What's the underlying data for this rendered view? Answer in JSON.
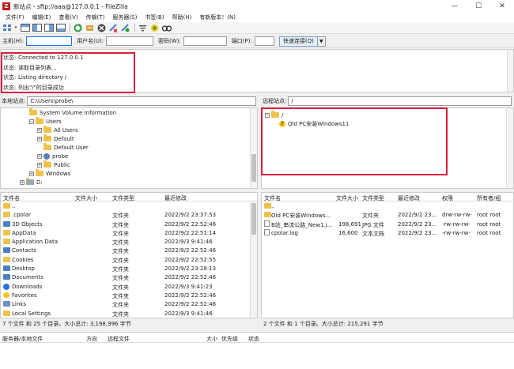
{
  "window": {
    "title": "新站点 - sftp://aaa@127.0.0.1 - FileZilla",
    "app_icon": "Z",
    "minimize": "—",
    "maximize": "☐",
    "close": "✕"
  },
  "menu": [
    "文件(F)",
    "编辑(E)",
    "查看(V)",
    "传输(T)",
    "服务器(S)",
    "书签(B)",
    "帮助(H)",
    "有新版本！(N)"
  ],
  "quickconnect": {
    "host_label": "主机(H):",
    "host_value": "",
    "user_label": "用户名(U):",
    "user_value": "",
    "pass_label": "密码(W):",
    "pass_value": "",
    "port_label": "端口(P):",
    "port_value": "",
    "connect_label": "快速连接(Q)",
    "dropdown": "▼"
  },
  "log": [
    {
      "key": "状态:",
      "msg": "Connected to 127.0.0.1"
    },
    {
      "key": "状态:",
      "msg": "读取目录列表..."
    },
    {
      "key": "状态:",
      "msg": "Listing directory /"
    },
    {
      "key": "状态:",
      "msg": "列出\"/\"的目录成功"
    }
  ],
  "local": {
    "site_label": "本地站点:",
    "path": "C:\\Users\\probe\\",
    "tree": [
      {
        "label": "System Volume Information",
        "expander": "",
        "icon": "folder"
      },
      {
        "label": "Users",
        "expander": "−",
        "icon": "folder"
      },
      {
        "label": "All Users",
        "expander": "+",
        "icon": "folder"
      },
      {
        "label": "Default",
        "expander": "+",
        "icon": "folder"
      },
      {
        "label": "Default User",
        "expander": "",
        "icon": "folder"
      },
      {
        "label": "probe",
        "expander": "+",
        "icon": "user"
      },
      {
        "label": "Public",
        "expander": "+",
        "icon": "folder"
      },
      {
        "label": "Windows",
        "expander": "+",
        "icon": "folder"
      },
      {
        "label": "D:",
        "expander": "+",
        "icon": "drive"
      }
    ],
    "columns": {
      "name": "文件名",
      "size": "文件大小",
      "type": "文件类型",
      "modified": "最近修改"
    },
    "files": [
      {
        "name": "..",
        "size": "",
        "type": "",
        "modified": "",
        "icon": "folder"
      },
      {
        "name": ".cpolar",
        "size": "",
        "type": "文件夹",
        "modified": "2022/9/2 23:37:53",
        "icon": "folder"
      },
      {
        "name": "3D Objects",
        "size": "",
        "type": "文件夹",
        "modified": "2022/9/2 22:52:46",
        "icon": "special"
      },
      {
        "name": "AppData",
        "size": "",
        "type": "文件夹",
        "modified": "2022/9/2 22:51:14",
        "icon": "folder"
      },
      {
        "name": "Application Data",
        "size": "",
        "type": "文件夹",
        "modified": "2022/9/3 9:41:46",
        "icon": "folder"
      },
      {
        "name": "Contacts",
        "size": "",
        "type": "文件夹",
        "modified": "2022/9/2 22:52:46",
        "icon": "special"
      },
      {
        "name": "Cookies",
        "size": "",
        "type": "文件夹",
        "modified": "2022/9/2 22:52:55",
        "icon": "folder"
      },
      {
        "name": "Desktop",
        "size": "",
        "type": "文件夹",
        "modified": "2022/9/2 23:28:13",
        "icon": "special"
      },
      {
        "name": "Documents",
        "size": "",
        "type": "文件夹",
        "modified": "2022/9/2 22:52:46",
        "icon": "special"
      },
      {
        "name": "Downloads",
        "size": "",
        "type": "文件夹",
        "modified": "2022/9/3 9:41:23",
        "icon": "dl"
      },
      {
        "name": "Favorites",
        "size": "",
        "type": "文件夹",
        "modified": "2022/9/2 22:52:46",
        "icon": "fav"
      },
      {
        "name": "Links",
        "size": "",
        "type": "文件夹",
        "modified": "2022/9/2 22:52:46",
        "icon": "link"
      },
      {
        "name": "Local Settings",
        "size": "",
        "type": "文件夹",
        "modified": "2022/9/3 9:41:46",
        "icon": "folder"
      }
    ],
    "summary": "7 个文件 和 25 个目录。大小总计: 3,198,996 字节"
  },
  "remote": {
    "site_label": "远程站点:",
    "path": "/",
    "tree": [
      {
        "label": "/",
        "expander": "−",
        "icon": "folder"
      },
      {
        "label": "Old PC安装Windows11",
        "expander": "",
        "icon": "question"
      }
    ],
    "columns": {
      "name": "文件名",
      "size": "文件大小",
      "type": "文件类型",
      "modified": "最近修改",
      "perms": "权限",
      "owner": "所有者/组"
    },
    "files": [
      {
        "name": "..",
        "size": "",
        "type": "",
        "modified": "",
        "perms": "",
        "owner": "",
        "icon": "folder"
      },
      {
        "name": "Old PC安装Windows...",
        "size": "",
        "type": "文件夹",
        "modified": "2022/9/2 23...",
        "perms": "drw-rw-rw-",
        "owner": "root root",
        "icon": "folder"
      },
      {
        "name": "B站_串流公路_New1.j...",
        "size": "198,691",
        "type": "JPG 文件",
        "modified": "2022/9/2 23...",
        "perms": "-rw-rw-rw-",
        "owner": "root root",
        "icon": "file"
      },
      {
        "name": "cpolar.log",
        "size": "16,600",
        "type": "文本文档",
        "modified": "2022/9/2 23...",
        "perms": "-rw-rw-rw-",
        "owner": "root root",
        "icon": "file"
      }
    ],
    "summary": "2 个文件 和 1 个目录。大小总计: 215,291 字节"
  },
  "queue": {
    "columns": {
      "server_file": "服务器/本地文件",
      "direction": "方向",
      "remote_file": "远程文件",
      "size": "大小",
      "priority": "优先级",
      "status": "状态"
    }
  }
}
